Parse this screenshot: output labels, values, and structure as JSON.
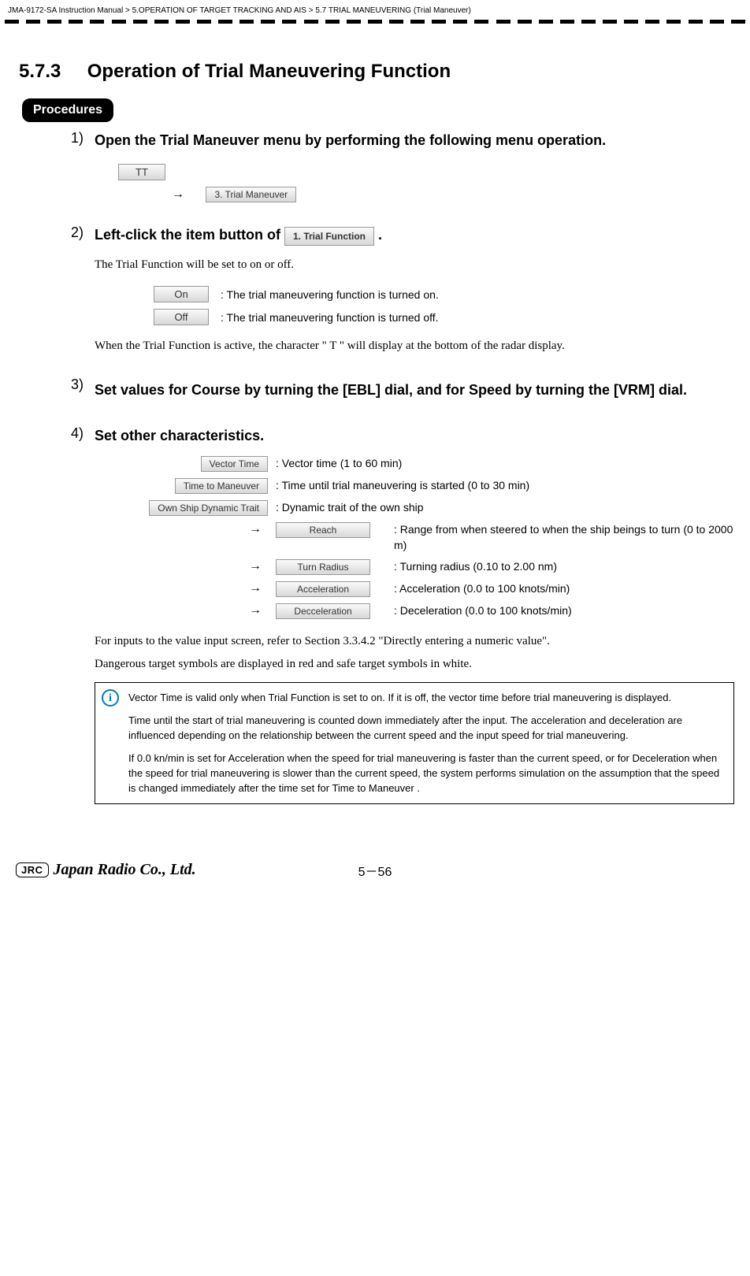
{
  "breadcrumb": {
    "manual": "JMA-9172-SA Instruction Manual",
    "chapter": "5.OPERATION OF TARGET TRACKING AND AIS",
    "section": "5.7  TRIAL MANEUVERING (Trial Maneuver)",
    "sep": ">"
  },
  "section": {
    "number": "5.7.3",
    "title": "Operation of Trial Maneuvering Function"
  },
  "procedures_label": "Procedures",
  "steps": {
    "s1": {
      "num": "1)",
      "title": "Open the Trial Maneuver menu by performing the following menu operation.",
      "btn_tt": "TT",
      "btn_trial_maneuver": "3. Trial Maneuver"
    },
    "s2": {
      "num": "2)",
      "title_pre": "Left-click the item button of ",
      "btn_trial_function": "1. Trial Function",
      "title_post": " .",
      "body1": "The Trial Function will be set to on or off.",
      "on_label": "On",
      "on_desc": ": The trial maneuvering function is turned on.",
      "off_label": "Off",
      "off_desc": ": The trial maneuvering function is turned off.",
      "body2": "When the Trial Function is active, the character \" T \" will display at the bottom of the radar display."
    },
    "s3": {
      "num": "3)",
      "title": "Set values for Course by turning the [EBL] dial, and for Speed by turning the [VRM] dial."
    },
    "s4": {
      "num": "4)",
      "title": "Set other characteristics.",
      "rows": {
        "vector_time": {
          "btn": "Vector Time",
          "desc": ": Vector time (1 to 60 min)"
        },
        "time_to_maneuver": {
          "btn": "Time to Maneuver",
          "desc": ": Time until trial maneuvering is started (0 to 30 min)"
        },
        "own_ship": {
          "btn": "Own Ship Dynamic Trait",
          "desc": ": Dynamic trait of the own ship"
        },
        "reach": {
          "btn": "Reach",
          "desc": ": Range from when steered to when the ship beings to turn (0 to 2000 m)"
        },
        "turn_radius": {
          "btn": "Turn Radius",
          "desc": ": Turning radius (0.10 to 2.00 nm)"
        },
        "acceleration": {
          "btn": "Acceleration",
          "desc": ": Acceleration (0.0 to 100 knots/min)"
        },
        "deceleration": {
          "btn": "Decceleration",
          "desc": ": Deceleration (0.0 to 100 knots/min)"
        }
      },
      "body1": "For inputs to the value input screen, refer to Section 3.3.4.2 \"Directly entering a numeric value\".",
      "body2": "Dangerous target symbols are displayed in red and safe target symbols in white."
    }
  },
  "arrow": "→",
  "info": {
    "p1": "Vector Time is valid only when Trial Function is set to on. If it is off, the vector time before trial maneuvering is displayed.",
    "p2": "Time until the start of trial maneuvering is counted down immediately after the input. The acceleration and deceleration are influenced depending on the relationship between the current speed and the input speed for trial maneuvering.",
    "p3": "If 0.0 kn/min is set for  Acceleration  when the speed for trial maneuvering is faster than the current speed, or for  Deceleration  when the speed for trial maneuvering is slower than the current speed, the system performs simulation on the assumption that the speed is changed immediately after the time set for Time to Maneuver ."
  },
  "footer": {
    "jrc": "JRC",
    "company": "Japan Radio Co., Ltd.",
    "page": "5－56"
  }
}
